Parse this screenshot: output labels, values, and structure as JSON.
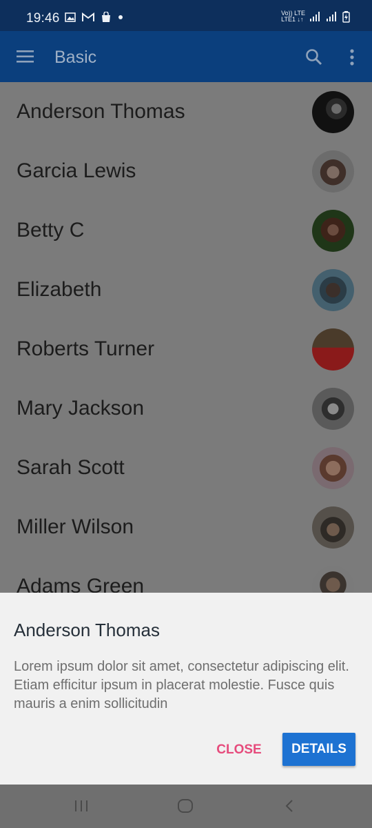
{
  "status_bar": {
    "time": "19:46",
    "carrier_line1": "Vo)) LTE",
    "carrier_line2": "LTE1 ↓↑"
  },
  "app_bar": {
    "title": "Basic"
  },
  "contacts": [
    {
      "name": "Anderson Thomas"
    },
    {
      "name": "Garcia Lewis"
    },
    {
      "name": "Betty C"
    },
    {
      "name": "Elizabeth"
    },
    {
      "name": "Roberts Turner"
    },
    {
      "name": "Mary Jackson"
    },
    {
      "name": "Sarah Scott"
    },
    {
      "name": "Miller Wilson"
    },
    {
      "name": "Adams Green"
    }
  ],
  "sheet": {
    "title": "Anderson Thomas",
    "body": "Lorem ipsum dolor sit amet, consectetur adipiscing elit. Etiam efficitur ipsum in placerat molestie. Fusce quis mauris a enim sollicitudin",
    "close_label": "CLOSE",
    "details_label": "DETAILS"
  },
  "colors": {
    "app_bar": "#0b3f7d",
    "status_bar": "#0d2f5c",
    "accent_pink": "#e64b7c",
    "primary_blue": "#1d72d2",
    "sheet_bg": "#f1f1f1"
  },
  "icons": [
    "gallery-icon",
    "gmail-icon",
    "shopping-bag-icon",
    "notification-dot-icon",
    "signal-icon",
    "battery-icon",
    "menu-icon",
    "search-icon",
    "more-vert-icon",
    "recents-icon",
    "home-icon",
    "back-icon"
  ]
}
